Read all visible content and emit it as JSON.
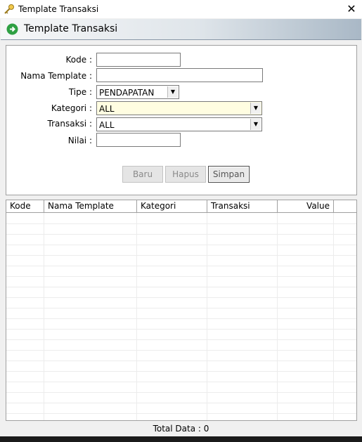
{
  "window": {
    "title": "Template Transaksi",
    "close_glyph": "✕"
  },
  "header": {
    "title": "Template Transaksi"
  },
  "form": {
    "kode": {
      "label": "Kode  :",
      "value": ""
    },
    "nama_template": {
      "label": "Nama Template  :",
      "value": ""
    },
    "tipe": {
      "label": "Tipe  :",
      "value": "PENDAPATAN"
    },
    "kategori": {
      "label": "Kategori :",
      "value": "ALL"
    },
    "transaksi": {
      "label": "Transaksi :",
      "value": "ALL"
    },
    "nilai": {
      "label": "Nilai  :",
      "value": ""
    }
  },
  "buttons": {
    "baru": "Baru",
    "hapus": "Hapus",
    "simpan": "Simpan"
  },
  "table": {
    "columns": [
      "Kode",
      "Nama Template",
      "Kategori",
      "Transaksi",
      "Value"
    ],
    "rows": []
  },
  "footer": {
    "total_label": "Total Data : 0"
  },
  "colors": {
    "kategori_highlight": "#fffde1",
    "header_gradient_end": "#a9b8c6"
  },
  "icons": {
    "app": "key-icon",
    "header": "green-arrow-icon",
    "close": "close-icon",
    "dropdown": "chevron-down-icon"
  }
}
